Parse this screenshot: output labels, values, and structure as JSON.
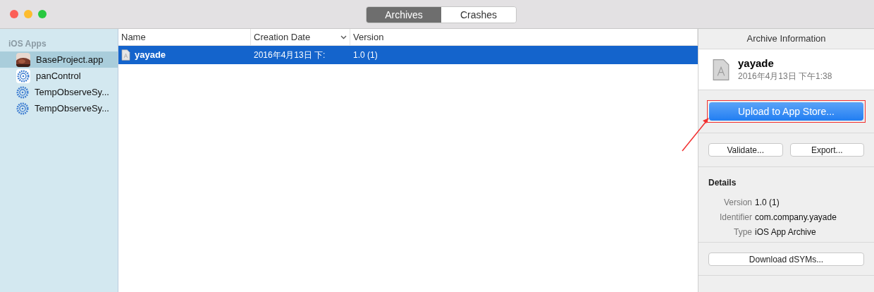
{
  "tabs": [
    {
      "label": "Archives",
      "selected": true
    },
    {
      "label": "Crashes",
      "selected": false
    }
  ],
  "sidebar": {
    "section": "iOS Apps",
    "items": [
      {
        "label": "BaseProject.app",
        "selected": true
      },
      {
        "label": "panControl",
        "kind": "gear-tile",
        "selected": false
      },
      {
        "label": "TempObserveSy...",
        "kind": "gear",
        "selected": false
      },
      {
        "label": "TempObserveSy...",
        "kind": "gear",
        "selected": false
      }
    ]
  },
  "table": {
    "columns": [
      {
        "label": "Name",
        "sorted": false
      },
      {
        "label": "Creation Date",
        "sorted": true
      },
      {
        "label": "Version",
        "sorted": false
      }
    ],
    "rows": [
      {
        "name": "yayade",
        "date": "2016年4月13日 下:",
        "version": "1.0 (1)",
        "selected": true
      }
    ]
  },
  "info": {
    "title": "Archive Information",
    "name": "yayade",
    "date": "2016年4月13日 下午1:38",
    "upload": {
      "label": "Upload to App Store...",
      "annotated": true
    },
    "buttons": [
      "Validate...",
      "Export..."
    ],
    "details_title": "Details",
    "details": [
      {
        "key": "Version",
        "value": "1.0 (1)"
      },
      {
        "key": "Identifier",
        "value": "com.company.yayade"
      },
      {
        "key": "Type",
        "value": "iOS App Archive"
      }
    ],
    "download": "Download dSYMs..."
  }
}
